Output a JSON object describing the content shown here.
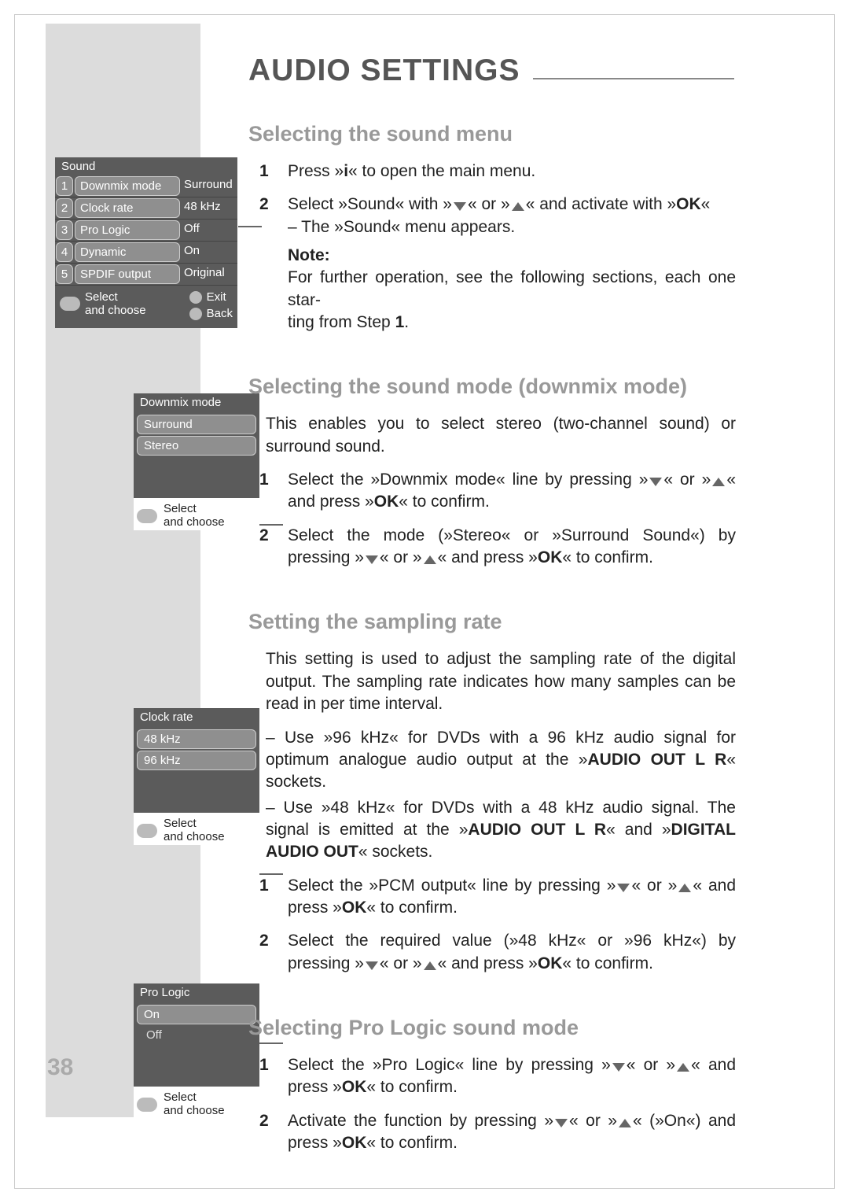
{
  "page_number": "38",
  "page_title": "AUDIO SETTINGS",
  "sec1": {
    "heading": "Selecting the sound menu",
    "step1": {
      "n": "1",
      "text_a": "Press »",
      "key": "i",
      "text_b": "« to open the main menu."
    },
    "step2": {
      "n": "2",
      "text_a": "Select »Sound« with »",
      "text_b": "« or »",
      "text_c": "« and activate with »",
      "ok": "OK",
      "text_d": "«",
      "line2": "– The »Sound« menu appears.",
      "note_h": "Note:",
      "note_a": "For further operation, see the following sections, each one star-",
      "note_b": "ting from  Step ",
      "note_num": "1",
      "note_c": "."
    }
  },
  "sec2": {
    "heading": "Selecting the sound mode (downmix mode)",
    "intro": "This enables you to select stereo (two-channel sound) or surround sound.",
    "step1": {
      "n": "1",
      "text_a": "Select the »Downmix mode« line by pressing »",
      "text_b": "« or »",
      "text_c": "« and press »",
      "ok": "OK",
      "text_d": "« to confirm."
    },
    "step2": {
      "n": "2",
      "text_a": "Select the mode (»Stereo« or »Surround Sound«) by pressing »",
      "text_b": "« or »",
      "text_c": "« and press »",
      "ok": "OK",
      "text_d": "« to confirm."
    }
  },
  "sec3": {
    "heading": "Setting the sampling rate",
    "intro1": "This setting is used to adjust the sampling rate of the digital output. The sampling rate indicates how many samples can be read in per time interval.",
    "bullet1_a": "– Use »96 kHz« for DVDs with a 96 kHz audio signal for optimum analogue audio output at the »",
    "bullet1_b": "AUDIO OUT L R",
    "bullet1_c": "« sockets.",
    "bullet2_a": "– Use »48 kHz« for DVDs with a 48 kHz audio signal. The signal is emitted at the »",
    "bullet2_b": "AUDIO OUT L R",
    "bullet2_c": "« and »",
    "bullet2_d": "DIGITAL AUDIO OUT",
    "bullet2_e": "« sockets.",
    "step1": {
      "n": "1",
      "text_a": "Select the »PCM output« line by pressing »",
      "text_b": "« or »",
      "text_c": "« and press »",
      "ok": "OK",
      "text_d": "« to confirm."
    },
    "step2": {
      "n": "2",
      "text_a": "Select the required value (»48 kHz« or »96 kHz«) by pressing »",
      "text_b": "« or »",
      "text_c": "« and press »",
      "ok": "OK",
      "text_d": "« to confirm."
    }
  },
  "sec4": {
    "heading": "Selecting Pro Logic sound mode",
    "step1": {
      "n": "1",
      "text_a": "Select the »Pro Logic« line by pressing »",
      "text_b": "« or »",
      "text_c": "« and press »",
      "ok": "OK",
      "text_d": "« to confirm."
    },
    "step2": {
      "n": "2",
      "text_a": "Activate the function by pressing »",
      "text_b": "« or »",
      "text_c": "« (»On«) and press »",
      "ok": "OK",
      "text_d": "« to confirm."
    }
  },
  "sound_menu": {
    "title": "Sound",
    "rows": [
      {
        "n": "1",
        "name": "Downmix mode",
        "val": "Surround"
      },
      {
        "n": "2",
        "name": "Clock rate",
        "val": "48 kHz"
      },
      {
        "n": "3",
        "name": "Pro  Logic",
        "val": "Off"
      },
      {
        "n": "4",
        "name": "Dynamic",
        "val": "On"
      },
      {
        "n": "5",
        "name": "SPDIF output",
        "val": "Original"
      }
    ],
    "select": "Select",
    "andchoose": "and choose",
    "exit": "Exit",
    "back": "Back"
  },
  "panel_downmix": {
    "title": "Downmix mode",
    "opt1": "Surround",
    "opt2": "Stereo",
    "select": "Select",
    "andchoose": "and choose"
  },
  "panel_clock": {
    "title": "Clock rate",
    "opt1": "48 kHz",
    "opt2": "96 kHz",
    "select": "Select",
    "andchoose": "and choose"
  },
  "panel_prologic": {
    "title": "Pro Logic",
    "opt1": "On",
    "opt2": "Off",
    "select": "Select",
    "andchoose": "and choose"
  }
}
